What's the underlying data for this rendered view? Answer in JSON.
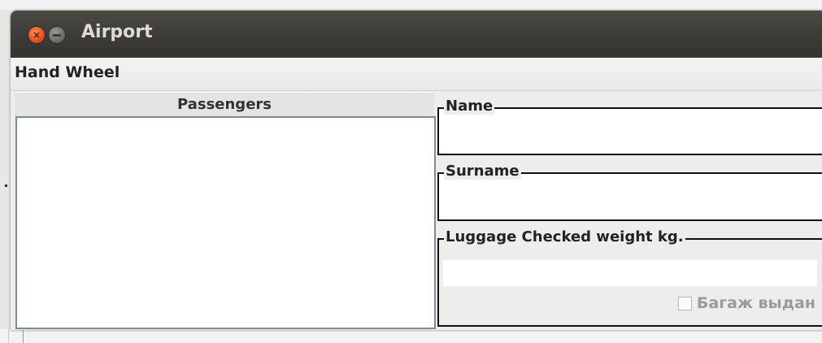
{
  "window": {
    "title": "Airport"
  },
  "menu": {
    "items": [
      "Hand Wheel"
    ]
  },
  "passengers": {
    "header": "Passengers",
    "items": []
  },
  "form": {
    "name": {
      "legend": "Name",
      "value": ""
    },
    "surname": {
      "legend": "Surname",
      "value": ""
    },
    "luggage": {
      "legend": "Luggage Checked weight kg.",
      "value": "",
      "checkbox_label": "Багаж выдан",
      "checked": false
    }
  }
}
